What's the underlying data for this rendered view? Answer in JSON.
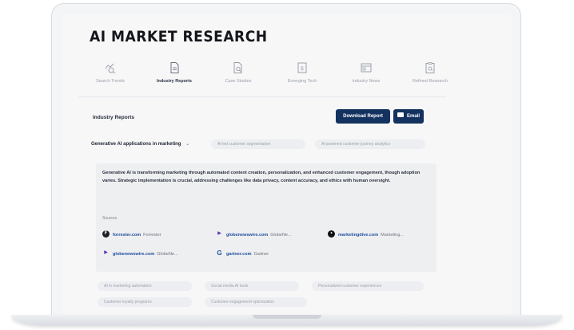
{
  "app": {
    "title": "AI MARKET RESEARCH"
  },
  "tabs": [
    {
      "label": "Search Trends",
      "icon": "search-trend-icon",
      "active": false
    },
    {
      "label": "Industry Reports",
      "icon": "document-icon",
      "active": true
    },
    {
      "label": "Case Studies",
      "icon": "document-search-icon",
      "active": false
    },
    {
      "label": "Emerging Tech",
      "icon": "dollar-doc-icon",
      "active": false
    },
    {
      "label": "Industry News",
      "icon": "news-icon",
      "active": false
    },
    {
      "label": "Refined Research",
      "icon": "clipboard-search-icon",
      "active": false
    }
  ],
  "section": {
    "title": "Industry Reports"
  },
  "buttons": {
    "download": "Download Report",
    "email": "Email"
  },
  "topics": {
    "active": "Generative AI applications in marketing",
    "others": [
      "AI-led customer segmentation",
      "AI-powered customer journey analytics"
    ]
  },
  "report": {
    "summary": "Generative AI is transforming marketing through automated content creation, personalization, and enhanced customer engagement, though adoption varies. Strategic implementation is crucial, addressing challenges like data privacy, content accuracy, and ethics with human oversight.",
    "sources_label": "Sources",
    "sources": [
      {
        "domain": "forrester.com",
        "name": "Forrester",
        "icon": "forrester-logo-icon",
        "color": "#1b1f27"
      },
      {
        "domain": "globenewswire.com",
        "name": "GlobeNe...",
        "icon": "globenewswire-logo-icon",
        "color": "#5a2fb8"
      },
      {
        "domain": "marketingdive.com",
        "name": "Marketing...",
        "icon": "marketingdive-logo-icon",
        "color": "#111111"
      },
      {
        "domain": "globenewswire.com",
        "name": "GlobeNe...",
        "icon": "globenewswire-logo-icon",
        "color": "#5a2fb8"
      },
      {
        "domain": "gartner.com",
        "name": "Gartner",
        "icon": "gartner-logo-icon",
        "color": "#1f4fa0"
      }
    ]
  },
  "related_topics": [
    "AI in marketing automation",
    "Social media AI tools",
    "Personalized customer experiences",
    "Customer loyalty programs",
    "Customer engagement optimization"
  ],
  "colors": {
    "primary": "#14325f",
    "link": "#1f4fa0",
    "card": "#eeeff1"
  }
}
